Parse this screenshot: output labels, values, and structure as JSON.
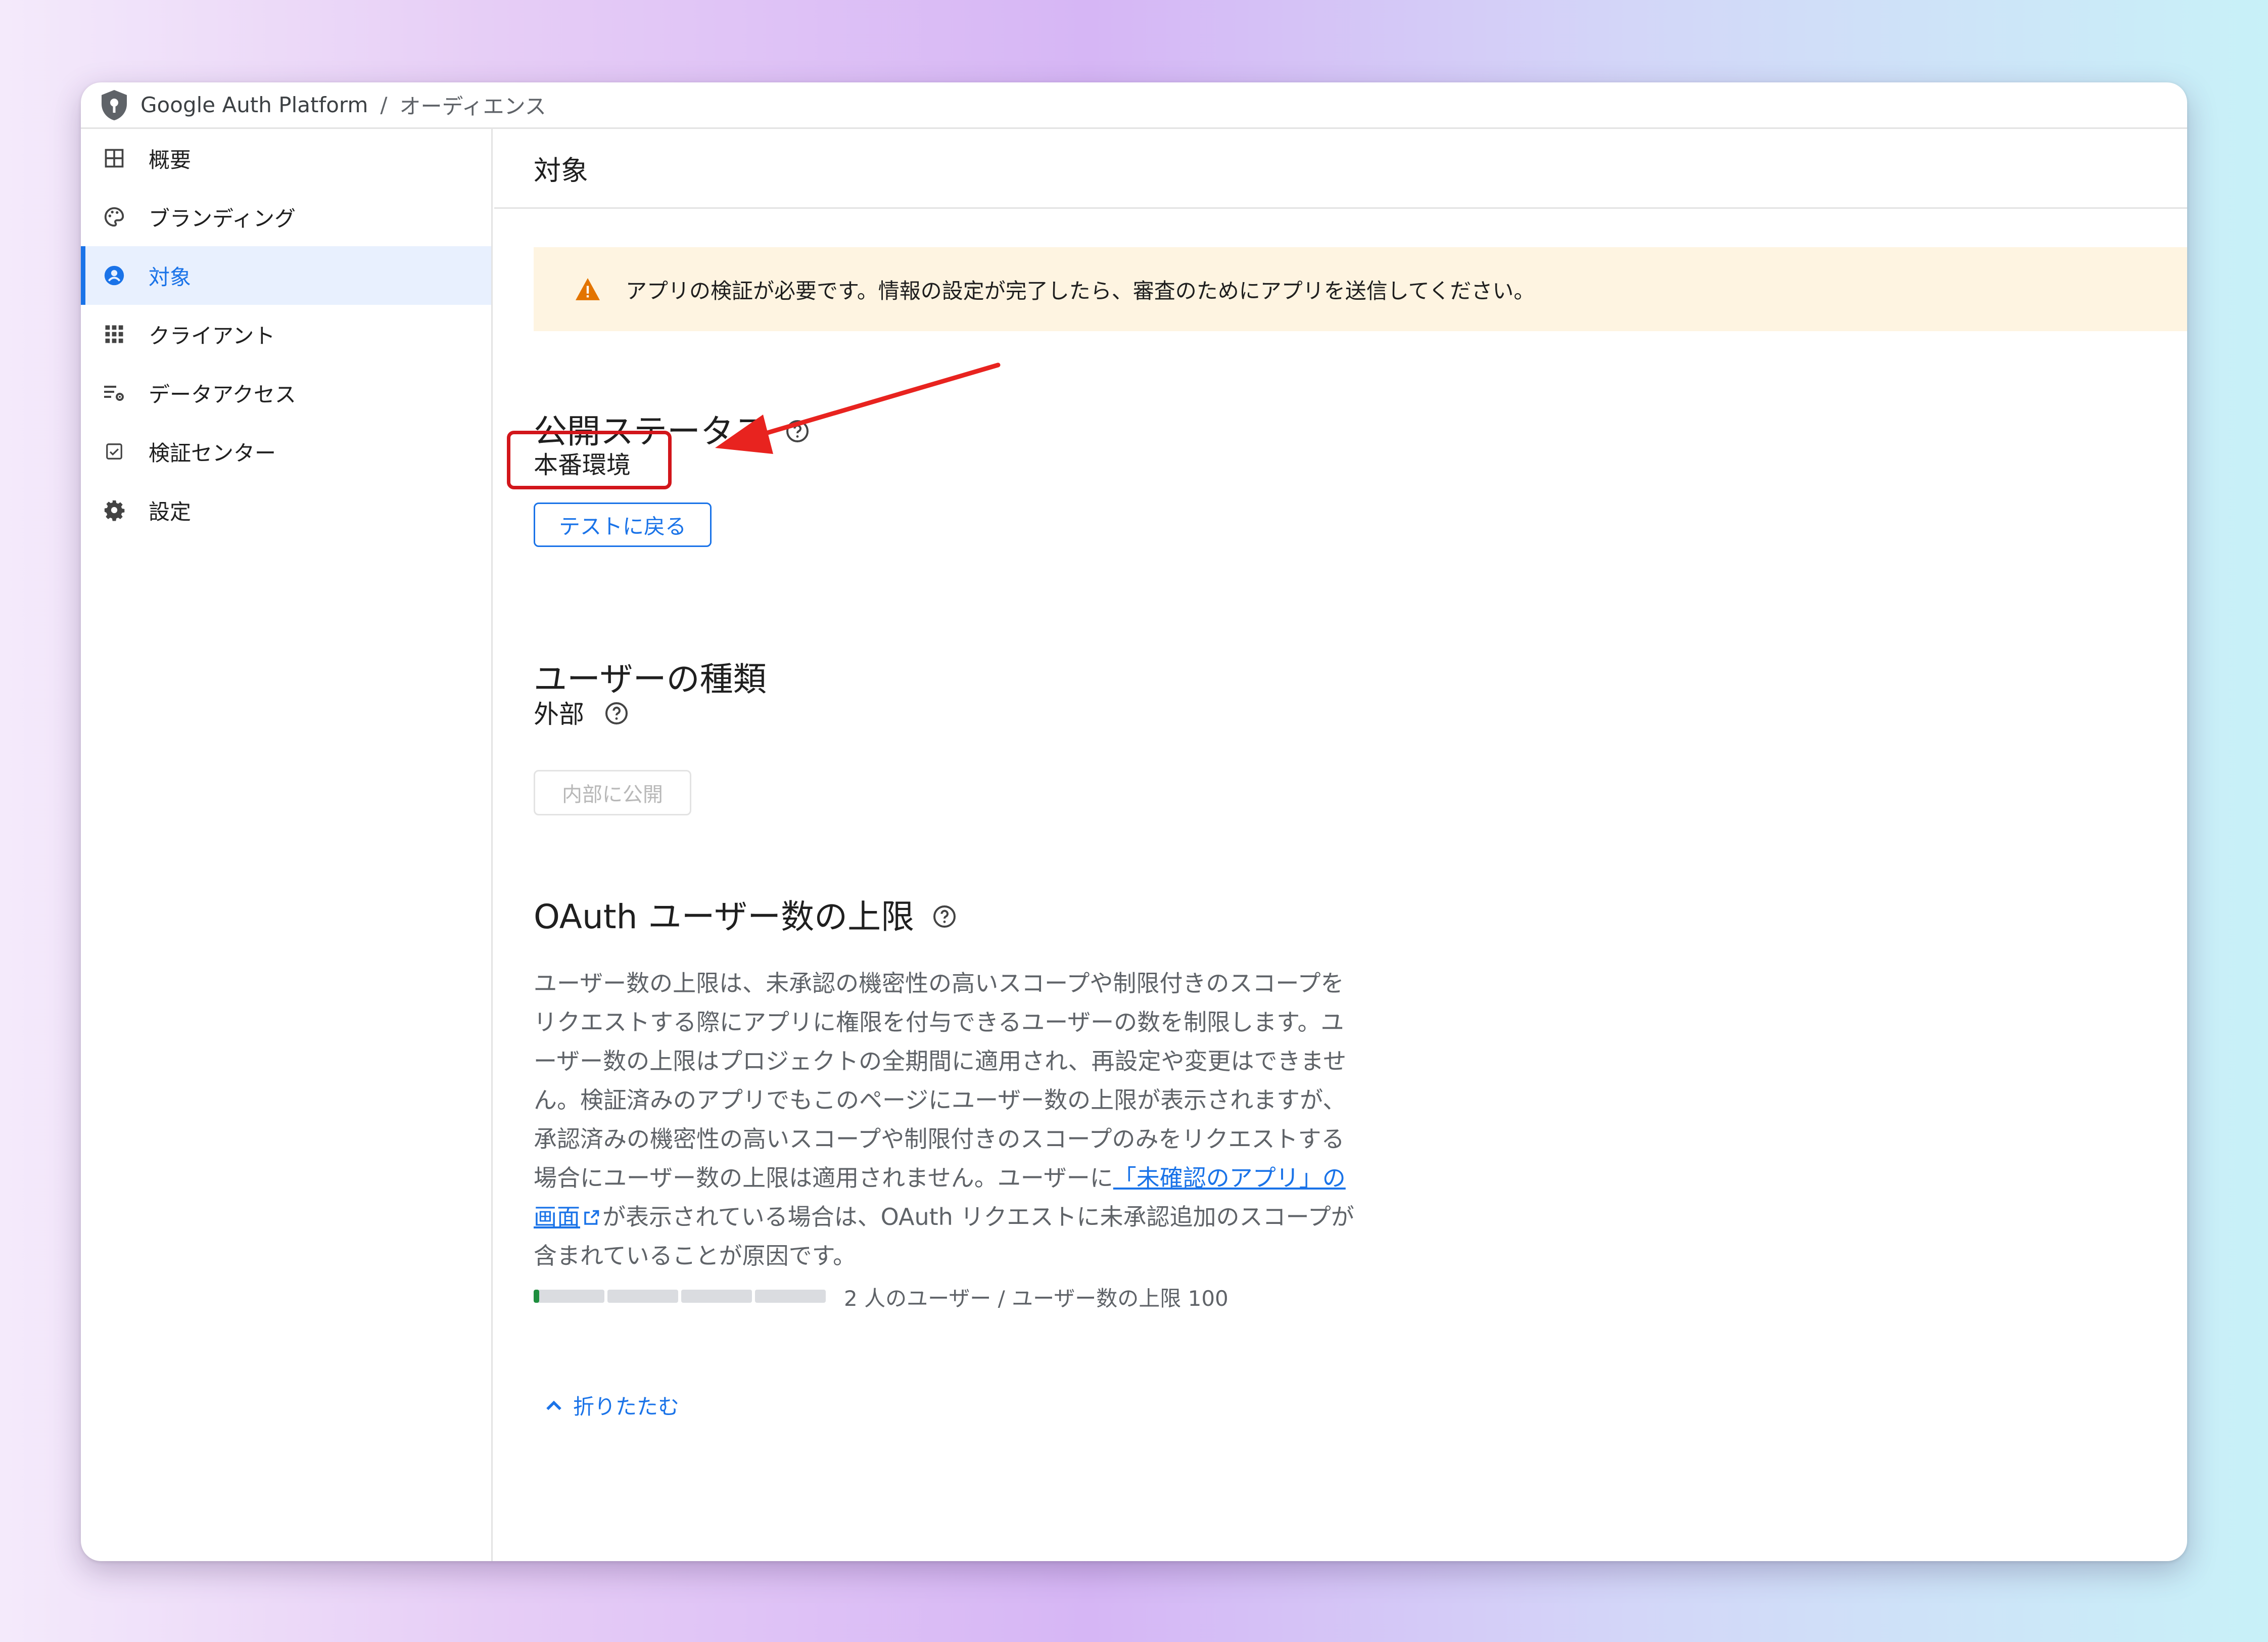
{
  "breadcrumb": {
    "app_name": "Google Auth Platform",
    "separator": "/",
    "current": "オーディエンス"
  },
  "sidebar": {
    "items": [
      {
        "label": "概要",
        "icon": "dashboard-icon",
        "active": false
      },
      {
        "label": "ブランディング",
        "icon": "palette-icon",
        "active": false
      },
      {
        "label": "対象",
        "icon": "account-circle-icon",
        "active": true
      },
      {
        "label": "クライアント",
        "icon": "apps-grid-icon",
        "active": false
      },
      {
        "label": "データアクセス",
        "icon": "data-access-icon",
        "active": false
      },
      {
        "label": "検証センター",
        "icon": "check-box-icon",
        "active": false
      },
      {
        "label": "設定",
        "icon": "gear-icon",
        "active": false
      }
    ]
  },
  "main": {
    "title": "対象",
    "banner": {
      "text": "アプリの検証が必要です。情報の設定が完了したら、審査のためにアプリを送信してください。",
      "icon": "warning-icon"
    },
    "publishing": {
      "heading": "公開ステータス",
      "status": "本番環境",
      "button": "テストに戻る"
    },
    "user_type": {
      "heading": "ユーザーの種類",
      "value": "外部",
      "button": "内部に公開"
    },
    "oauth_limit": {
      "heading": "OAuth ユーザー数の上限",
      "paragraph_before": "ユーザー数の上限は、未承認の機密性の高いスコープや制限付きのスコープをリクエストする際にアプリに権限を付与できるユーザーの数を制限します。ユーザー数の上限はプロジェクトの全期間に適用され、再設定や変更はできません。検証済みのアプリでもこのページにユーザー数の上限が表示されますが、承認済みの機密性の高いスコープや制限付きのスコープのみをリクエストする場合にユーザー数の上限は適用されません。ユーザーに",
      "link_text": "「未確認のアプリ」の画面",
      "paragraph_after": "が表示されている場合は、OAuth リクエストに未承認追加のスコープが含まれていることが原因です。",
      "progress_text": "2 人のユーザー / ユーザー数の上限 100",
      "users": 2,
      "limit": 100
    },
    "collapse_label": "折りたたむ"
  },
  "colors": {
    "accent": "#1a73e8",
    "warning_bg": "#fef4e1",
    "warning_icon": "#e37400",
    "highlight": "#d2161b",
    "progress": "#1e8e3e"
  }
}
